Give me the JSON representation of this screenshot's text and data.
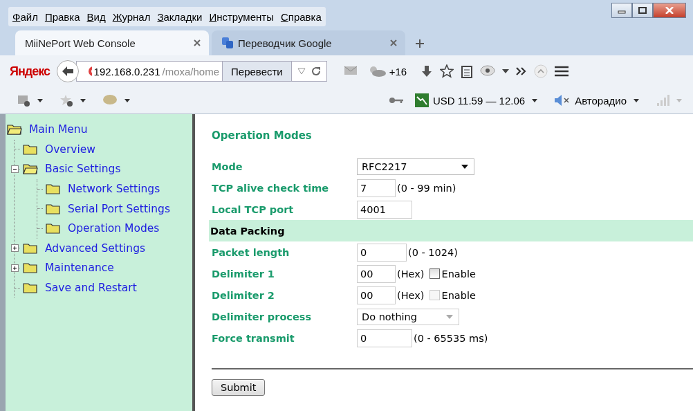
{
  "menu": [
    "Файл",
    "Правка",
    "Вид",
    "Журнал",
    "Закладки",
    "Инструменты",
    "Справка"
  ],
  "tabs": [
    {
      "label": "MiiNePort Web Console",
      "selected": true
    },
    {
      "label": "Переводчик Google",
      "selected": false
    }
  ],
  "nav": {
    "brand": "Яндекс",
    "url_host": "192.168.0.231",
    "url_path": "/moxa/home",
    "translate": "Перевести",
    "weather": "+16"
  },
  "bookmarks": {
    "currency": "USD 11.59 — 12.06",
    "radio": "Авторадио"
  },
  "sidebar": {
    "label": "Main Menu",
    "expanded": true,
    "children": [
      {
        "label": "Overview"
      },
      {
        "label": "Basic Settings",
        "expanded": true,
        "children": [
          {
            "label": "Network Settings"
          },
          {
            "label": "Serial Port Settings"
          },
          {
            "label": "Operation Modes"
          }
        ]
      },
      {
        "label": "Advanced Settings",
        "expanded": false
      },
      {
        "label": "Maintenance",
        "expanded": false
      },
      {
        "label": "Save and Restart"
      }
    ]
  },
  "form": {
    "title": "Operation Modes",
    "rows": [
      {
        "kind": "select",
        "label": "Mode",
        "value": "RFC2217",
        "disabled": false
      },
      {
        "kind": "input",
        "label": "TCP alive check time",
        "value": "7",
        "hint": "(0 - 99 min)"
      },
      {
        "kind": "input",
        "label": "Local TCP port",
        "value": "4001"
      },
      {
        "kind": "section",
        "label": "Data Packing"
      },
      {
        "kind": "input",
        "label": "Packet length",
        "value": "0",
        "hint": "(0 - 1024)"
      },
      {
        "kind": "delimiter",
        "label": "Delimiter 1",
        "value": "00",
        "hint": "(Hex)",
        "checkbox_label": "Enable",
        "checked": false,
        "disabled": false
      },
      {
        "kind": "delimiter",
        "label": "Delimiter 2",
        "value": "00",
        "hint": "(Hex)",
        "checkbox_label": "Enable",
        "checked": false,
        "disabled": true
      },
      {
        "kind": "select",
        "label": "Delimiter process",
        "value": "Do nothing",
        "disabled": true
      },
      {
        "kind": "input",
        "label": "Force transmit",
        "value": "0",
        "hint": "(0 - 65535 ms)"
      }
    ],
    "submit": "Submit"
  }
}
